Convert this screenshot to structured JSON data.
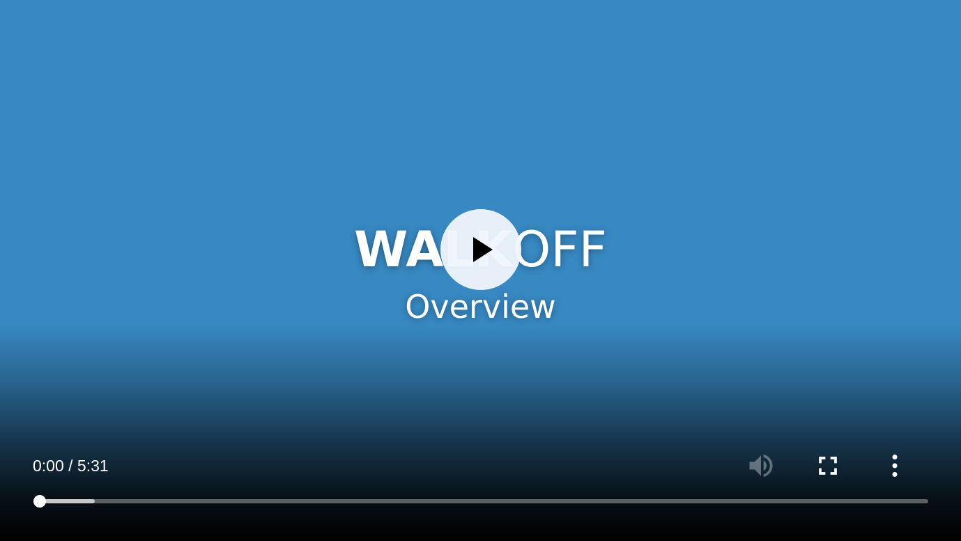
{
  "poster": {
    "title_bold": "WALK",
    "title_light": "OFF",
    "subtitle": "Overview"
  },
  "player": {
    "time_display": "0:00 / 5:31",
    "current_time": "0:00",
    "duration": "5:31",
    "progress_fraction": 0.0,
    "buffered_fraction": 0.055,
    "background_color": "#3888c2",
    "controls": {
      "play": "play-icon",
      "volume": "volume-icon",
      "fullscreen": "fullscreen-icon",
      "more": "more-vert-icon"
    }
  }
}
